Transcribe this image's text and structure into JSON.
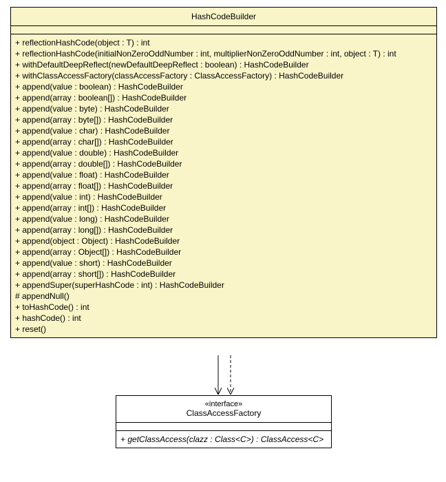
{
  "classes": {
    "hashCodeBuilder": {
      "name": "HashCodeBuilder",
      "methods": [
        "+ reflectionHashCode(object : T) : int",
        "+ reflectionHashCode(initialNonZeroOddNumber : int, multiplierNonZeroOddNumber : int, object : T) : int",
        "+ withDefaultDeepReflect(newDefaultDeepReflect : boolean) : HashCodeBuilder",
        "+ withClassAccessFactory(classAccessFactory : ClassAccessFactory) : HashCodeBuilder",
        "+ append(value : boolean) : HashCodeBuilder",
        "+ append(array : boolean[]) : HashCodeBuilder",
        "+ append(value : byte) : HashCodeBuilder",
        "+ append(array : byte[]) : HashCodeBuilder",
        "+ append(value : char) : HashCodeBuilder",
        "+ append(array : char[]) : HashCodeBuilder",
        "+ append(value : double) : HashCodeBuilder",
        "+ append(array : double[]) : HashCodeBuilder",
        "+ append(value : float) : HashCodeBuilder",
        "+ append(array : float[]) : HashCodeBuilder",
        "+ append(value : int) : HashCodeBuilder",
        "+ append(array : int[]) : HashCodeBuilder",
        "+ append(value : long) : HashCodeBuilder",
        "+ append(array : long[]) : HashCodeBuilder",
        "+ append(object : Object) : HashCodeBuilder",
        "+ append(array : Object[]) : HashCodeBuilder",
        "+ append(value : short) : HashCodeBuilder",
        "+ append(array : short[]) : HashCodeBuilder",
        "+ appendSuper(superHashCode : int) : HashCodeBuilder",
        "# appendNull()",
        "+ toHashCode() : int",
        "+ hashCode() : int",
        "+ reset()"
      ]
    },
    "classAccessFactory": {
      "stereotype": "«interface»",
      "name": "ClassAccessFactory",
      "methods": [
        "+ getClassAccess(clazz : Class<C>) : ClassAccess<C>"
      ]
    }
  },
  "colors": {
    "classFill": "#f9f5c8",
    "interfaceFill": "#ffffff",
    "border": "#000000"
  }
}
